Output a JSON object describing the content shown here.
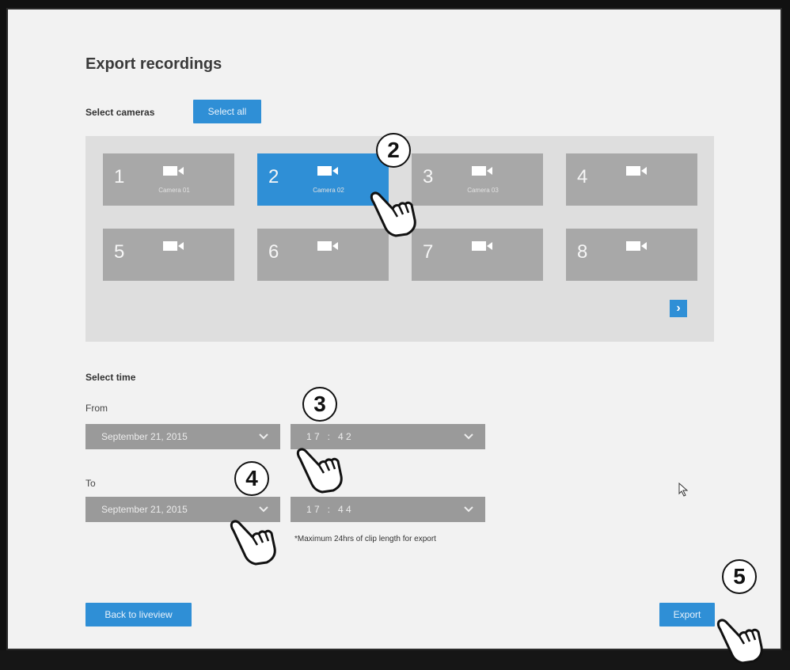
{
  "page": {
    "title": "Export recordings"
  },
  "cameras": {
    "section_label": "Select cameras",
    "select_all_label": "Select all",
    "tiles": [
      {
        "number": "1",
        "name": "Camera 01",
        "selected": false
      },
      {
        "number": "2",
        "name": "Camera 02",
        "selected": true
      },
      {
        "number": "3",
        "name": "Camera 03",
        "selected": false
      },
      {
        "number": "4",
        "name": "",
        "selected": false
      },
      {
        "number": "5",
        "name": "",
        "selected": false
      },
      {
        "number": "6",
        "name": "",
        "selected": false
      },
      {
        "number": "7",
        "name": "",
        "selected": false
      },
      {
        "number": "8",
        "name": "",
        "selected": false
      }
    ],
    "next_page_label": "›"
  },
  "time": {
    "section_label": "Select time",
    "from_label": "From",
    "to_label": "To",
    "from_date": "September 21, 2015",
    "from_time": "1 7   :   4 2",
    "to_date": "September 21, 2015",
    "to_time": "1 7   :   4 4",
    "note": "*Maximum 24hrs of clip length for export"
  },
  "footer": {
    "back_label": "Back to liveview",
    "export_label": "Export"
  },
  "callouts": [
    "2",
    "3",
    "4",
    "5"
  ],
  "colors": {
    "accent": "#2f8fd6",
    "tile": "#a8a8a8",
    "panel": "#dedede",
    "select": "#9a9a9a"
  },
  "icons": [
    "video-camera-icon",
    "chevron-down-icon",
    "chevron-right-icon",
    "pointing-hand-icon",
    "mouse-cursor-icon"
  ]
}
